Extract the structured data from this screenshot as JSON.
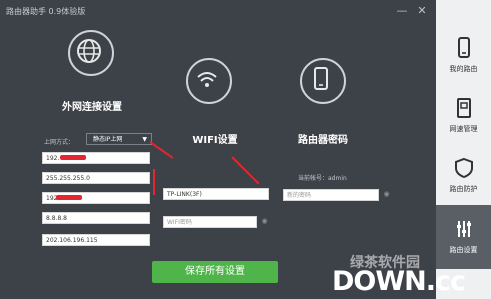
{
  "app": {
    "title": "路由器助手 0.9体验版"
  },
  "window": {
    "minimize": "—",
    "close": "✕"
  },
  "sidebar": {
    "items": [
      {
        "label": "我的路由",
        "icon": "phone-icon",
        "active": false
      },
      {
        "label": "网速管理",
        "icon": "device-icon",
        "active": false
      },
      {
        "label": "路由防护",
        "icon": "shield-icon",
        "active": false
      },
      {
        "label": "路由设置",
        "icon": "sliders-icon",
        "active": true
      }
    ]
  },
  "wan": {
    "title": "外网连接设置",
    "mode_label": "上网方式：",
    "mode_value": "静态IP上网",
    "fields": [
      "192.",
      "255.255.255.0",
      "192.",
      "8.8.8.8",
      "202.106.196.115"
    ]
  },
  "wifi": {
    "title": "WIFI设置",
    "ssid": "TP-LINK(3F)",
    "password_placeholder": "WIFI密码"
  },
  "router_password": {
    "title": "路由器密码",
    "current_account": "当前帐号：admin",
    "new_password_placeholder": "新的密码"
  },
  "actions": {
    "save_label": "保存所有设置"
  },
  "watermark": {
    "cn": "绿茶软件园",
    "en": "DOWN.cc"
  },
  "colors": {
    "accent_green": "#4fb54b",
    "annotation_red": "#e3262f",
    "background": "#3d4148"
  }
}
